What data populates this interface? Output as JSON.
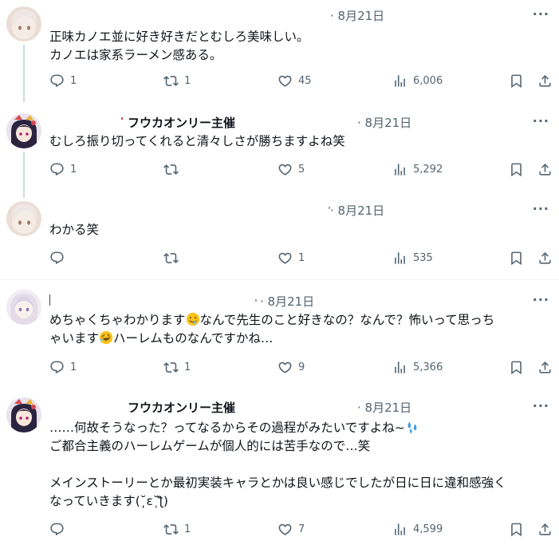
{
  "tweets": [
    {
      "name": "",
      "date": "· 8月21日",
      "text": "正味カノエ並に好き好きだとむしろ美味しい。\nカノエは家系ラーメン感ある。",
      "replies": "1",
      "retweets": "1",
      "likes": "45",
      "views": "6,006"
    },
    {
      "name": "フウカオンリー主催",
      "date": "· 8月21日",
      "text": "むしろ振り切ってくれると清々しさが勝ちますよね笑",
      "replies": "1",
      "retweets": "",
      "likes": "5",
      "views": "5,292"
    },
    {
      "name": "",
      "date": "· 8月21日",
      "text": "わかる笑",
      "replies": "",
      "retweets": "",
      "likes": "1",
      "views": "535"
    },
    {
      "name": "",
      "date": "· 8月21日",
      "text_a": "めちゃくちゃわかります",
      "text_b": "なんで先生のこと好きなの？なんで？怖いって思っち",
      "text_c": "ゃいます",
      "text_d": "ハーレムものなんですかね…",
      "replies": "1",
      "retweets": "1",
      "likes": "9",
      "views": "5,366"
    },
    {
      "name": "フウカオンリー主催",
      "date": "· 8月21日",
      "text_a": "……何故そうなった？ってなるからその過程がみたいですよね~",
      "text_b": "ご都合主義のハーレムゲームが個人的には苦手なので…笑",
      "text_c": "メインストーリーとか最初実装キャラとかは良い感じでしたが日に日に違和感強く",
      "text_d": "なっていきます(˘̩̩̩ε˘̩ƪ)",
      "replies": "",
      "retweets": "1",
      "likes": "7",
      "views": "4,599"
    }
  ],
  "more_label": "···",
  "icons": {
    "reply": "reply-icon",
    "retweet": "retweet-icon",
    "like": "heart-icon",
    "views": "views-icon",
    "bookmark": "bookmark-icon",
    "share": "share-icon"
  },
  "colors": {
    "text": "#0f1419",
    "secondary": "#536471",
    "thread_line": "#cfd9de",
    "divider": "#eff3f4"
  }
}
